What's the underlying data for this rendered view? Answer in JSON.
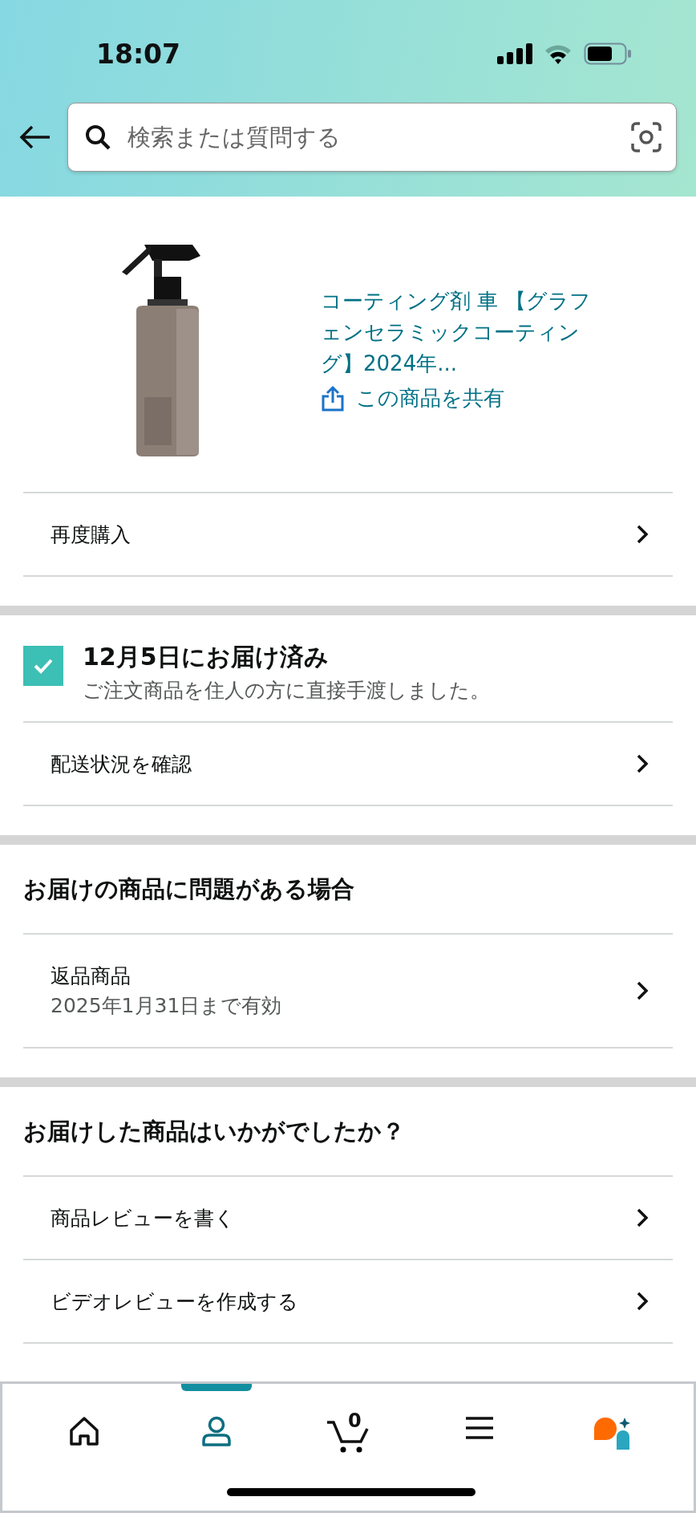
{
  "status_bar": {
    "time": "18:07"
  },
  "search": {
    "placeholder": "検索または質問する"
  },
  "product": {
    "title": "コーティング剤 車 【グラフェンセラミックコーティング】2024年...",
    "share": "この商品を共有"
  },
  "buy_again": {
    "label": "再度購入"
  },
  "delivery": {
    "checked": true,
    "title": "12月5日にお届け済み",
    "detail": "ご注文商品を住人の方に直接手渡しました。",
    "track": "配送状況を確認"
  },
  "sections": [
    {
      "heading": "お届けの商品に問題がある場合",
      "rows": [
        {
          "label": "返品商品",
          "sub": "2025年1月31日まで有効"
        }
      ]
    },
    {
      "heading": "お届けした商品はいかがでしたか？",
      "rows": [
        {
          "label": "商品レビューを書く"
        },
        {
          "label": "ビデオレビューを作成する"
        }
      ]
    }
  ],
  "nav": [
    {
      "kind": "home",
      "selected": false
    },
    {
      "kind": "account",
      "selected": true
    },
    {
      "kind": "cart",
      "count": "0",
      "selected": false
    },
    {
      "kind": "menu",
      "selected": false
    },
    {
      "kind": "assistant",
      "selected": false
    }
  ]
}
